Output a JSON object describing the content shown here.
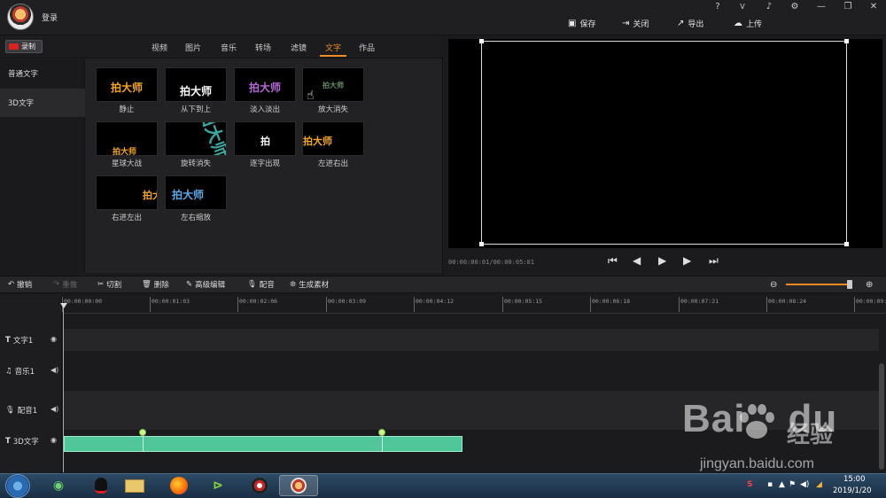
{
  "app": {
    "login": "登录",
    "window_icons": [
      "help-icon",
      "vip-icon",
      "bell-icon",
      "gear-icon",
      "minimize-icon",
      "restore-icon",
      "close-icon"
    ],
    "window_glyphs": [
      "?",
      "V",
      "♪",
      "⚙",
      "—",
      "❐",
      "✕"
    ],
    "actions": {
      "save": "保存",
      "close": "关闭",
      "export": "导出",
      "upload": "上传"
    }
  },
  "media": {
    "record": "录制",
    "tabs": [
      "视频",
      "图片",
      "音乐",
      "转场",
      "滤镜",
      "文字",
      "作品"
    ],
    "active_tab": "文字",
    "side": [
      "普通文字",
      "3D文字"
    ],
    "thumb_text": "拍大师",
    "thumb_text_single": "拍",
    "effects": [
      "静止",
      "从下到上",
      "淡入淡出",
      "放大消失",
      "星球大战",
      "旋转消失",
      "逐字出现",
      "左进右出",
      "右进左出",
      "左右缩放"
    ]
  },
  "preview": {
    "timecode": "00:00:00:01/00:00:05:01"
  },
  "toolbar": {
    "undo": "撤销",
    "redo": "重做",
    "cut": "切割",
    "delete": "删除",
    "advanced_edit": "高级编辑",
    "dub": "配音",
    "generate": "生成素材",
    "zoom_level": 0.95
  },
  "timeline": {
    "ticks": [
      "00:00:00:00",
      "00:00:01:03",
      "00:00:02:06",
      "00:00:03:09",
      "00:00:04:12",
      "00:00:05:15",
      "00:00:06:18",
      "00:00:07:21",
      "00:00:08:24",
      "00:00:09:"
    ],
    "tracks": [
      "文字1",
      "音乐1",
      "配音1",
      "3D文字"
    ]
  },
  "taskbar": {
    "time": "15:00",
    "date": "2019/1/20"
  },
  "watermark": {
    "brand": "Bai",
    "brand2": "du",
    "jingyan": "经验",
    "url": "jingyan.baidu.com"
  }
}
